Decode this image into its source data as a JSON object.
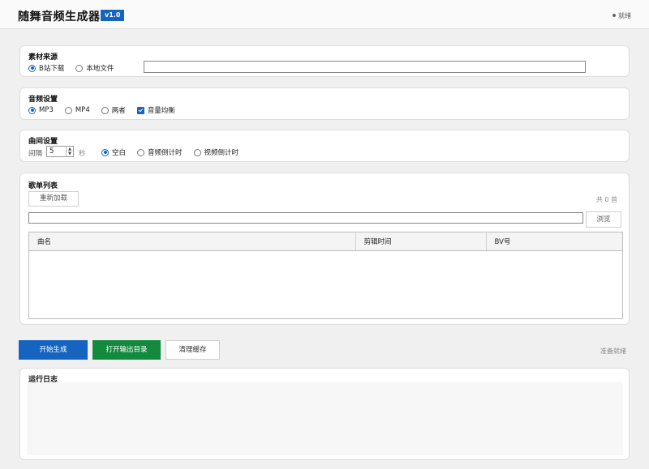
{
  "header": {
    "title": "随舞音频生成器",
    "version": "v1.0",
    "status": "就绪"
  },
  "source": {
    "title": "素材来源",
    "options": [
      "B站下载",
      "本地文件"
    ],
    "selected": "B站下载",
    "input_value": ""
  },
  "audio": {
    "title": "音频设置",
    "formats": [
      "MP3",
      "MP4",
      "两者"
    ],
    "selected": "MP3",
    "normalize_label": "音量均衡",
    "normalize_checked": true
  },
  "gap": {
    "title": "曲间设置",
    "interval_label": "间隔",
    "interval_value": "5",
    "unit": "秒",
    "modes": [
      "空白",
      "音频倒计时",
      "视频倒计时"
    ],
    "selected": "空白"
  },
  "playlist": {
    "title": "歌单列表",
    "reload_label": "重新加载",
    "count_text": "共 0 首",
    "path_value": "",
    "browse_label": "浏览",
    "columns": [
      "曲名",
      "剪辑时间",
      "BV号"
    ],
    "rows": []
  },
  "actions": {
    "start_label": "开始生成",
    "open_output_label": "打开输出目录",
    "clear_cache_label": "清理缓存",
    "status": "准备就绪"
  },
  "log": {
    "title": "运行日志",
    "content": ""
  },
  "colors": {
    "accent_blue": "#1565c0",
    "start_button": "#1565c0",
    "open_button": "#138a3e"
  }
}
